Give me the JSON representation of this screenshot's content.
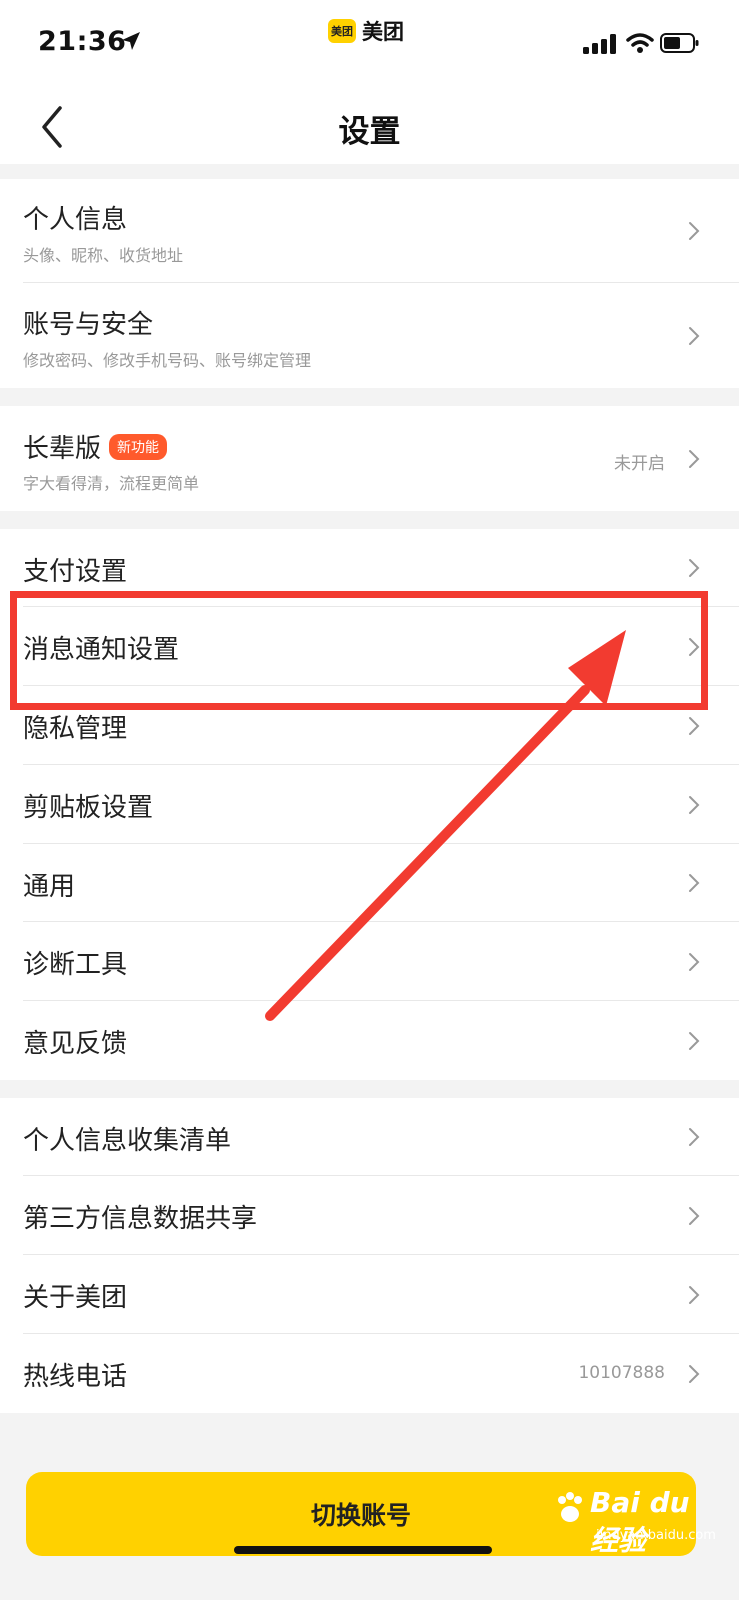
{
  "status_bar": {
    "time": "21:36",
    "app_name": "美团",
    "app_logo_text": "美团"
  },
  "nav": {
    "title": "设置"
  },
  "groups": [
    {
      "rows": [
        {
          "title": "个人信息",
          "subtitle": "头像、昵称、收货地址"
        },
        {
          "title": "账号与安全",
          "subtitle": "修改密码、修改手机号码、账号绑定管理"
        }
      ]
    },
    {
      "rows": [
        {
          "title": "长辈版",
          "badge": "新功能",
          "subtitle": "字大看得清，流程更简单",
          "value": "未开启"
        }
      ]
    },
    {
      "rows": [
        {
          "title": "支付设置"
        },
        {
          "title": "消息通知设置"
        },
        {
          "title": "隐私管理"
        },
        {
          "title": "剪贴板设置"
        },
        {
          "title": "通用"
        },
        {
          "title": "诊断工具"
        },
        {
          "title": "意见反馈"
        }
      ]
    },
    {
      "rows": [
        {
          "title": "个人信息收集清单"
        },
        {
          "title": "第三方信息数据共享"
        },
        {
          "title": "关于美团"
        },
        {
          "title": "热线电话",
          "value": "10107888"
        }
      ]
    }
  ],
  "switch_account_label": "切换账号",
  "watermark": {
    "text": "Bai du 经验",
    "sub": "jingyan.baidu.com"
  },
  "colors": {
    "brand_yellow": "#ffd100",
    "annotation_red": "#f23b30",
    "badge_orange": "#ff5a2c"
  }
}
